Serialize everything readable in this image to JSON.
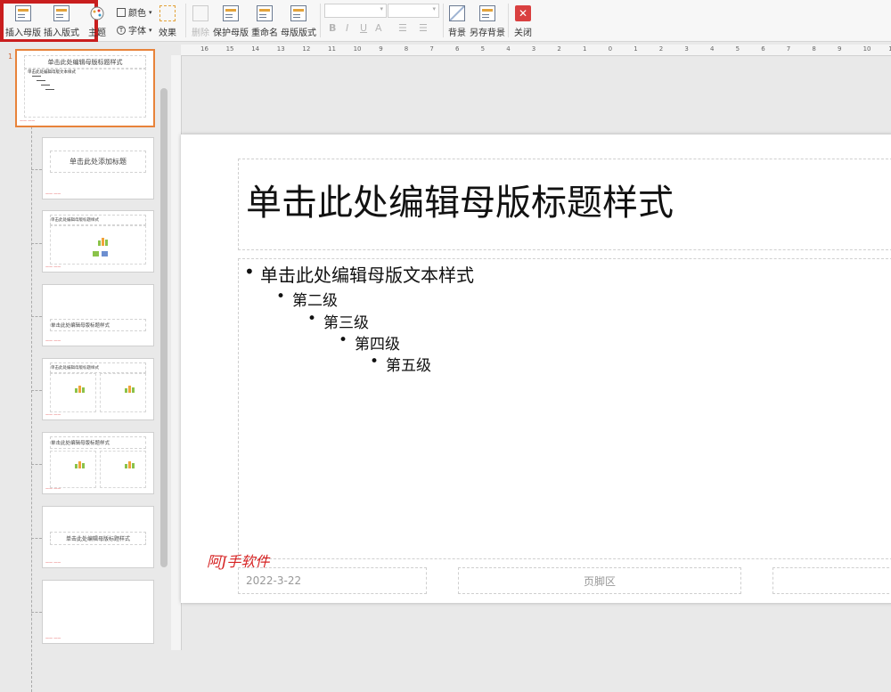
{
  "ribbon": {
    "insert_master": "插入母版",
    "insert_layout": "插入版式",
    "theme": "主题",
    "color": "颜色",
    "font": "字体",
    "effect": "效果",
    "delete": "删除",
    "protect_master": "保护母版",
    "rename": "重命名",
    "master_layout": "母版版式",
    "background": "背景",
    "save_background": "另存背景",
    "close": "关闭",
    "bold": "B",
    "italic": "I",
    "underline": "U",
    "font_color": "A"
  },
  "colors": {
    "accent": "#c91e1e",
    "thumb_selected": "#e8833a"
  },
  "ruler": {
    "ticks": [
      "16",
      "15",
      "14",
      "13",
      "12",
      "11",
      "10",
      "9",
      "8",
      "7",
      "6",
      "5",
      "4",
      "3",
      "2",
      "1",
      "0",
      "1",
      "2",
      "3",
      "4",
      "5",
      "6",
      "7",
      "8",
      "9",
      "10",
      "11",
      "12",
      "13",
      "14",
      "15",
      "16"
    ]
  },
  "panel": {
    "slide_number": "1",
    "thumbs": [
      {
        "title": "单击此处编辑母版标题样式",
        "body": "单击此处编辑母版文本样式"
      },
      {
        "title": "单击此处添加标题"
      },
      {
        "title": "单击此处编辑母版标题样式"
      },
      {
        "title": "单击此处编辑母版标题样式"
      },
      {
        "title": "单击此处编辑母版标题样式"
      },
      {
        "title": "单击此处编辑母版标题样式"
      },
      {
        "title": "单击此处编辑母版标题样式"
      },
      {
        "title": ""
      }
    ]
  },
  "slide": {
    "title": "单击此处编辑母版标题样式",
    "levels": [
      "单击此处编辑母版文本样式",
      "第二级",
      "第三级",
      "第四级",
      "第五级"
    ],
    "date": "2022-3-22",
    "footer": "页脚区",
    "watermark": "阿J手软件"
  }
}
